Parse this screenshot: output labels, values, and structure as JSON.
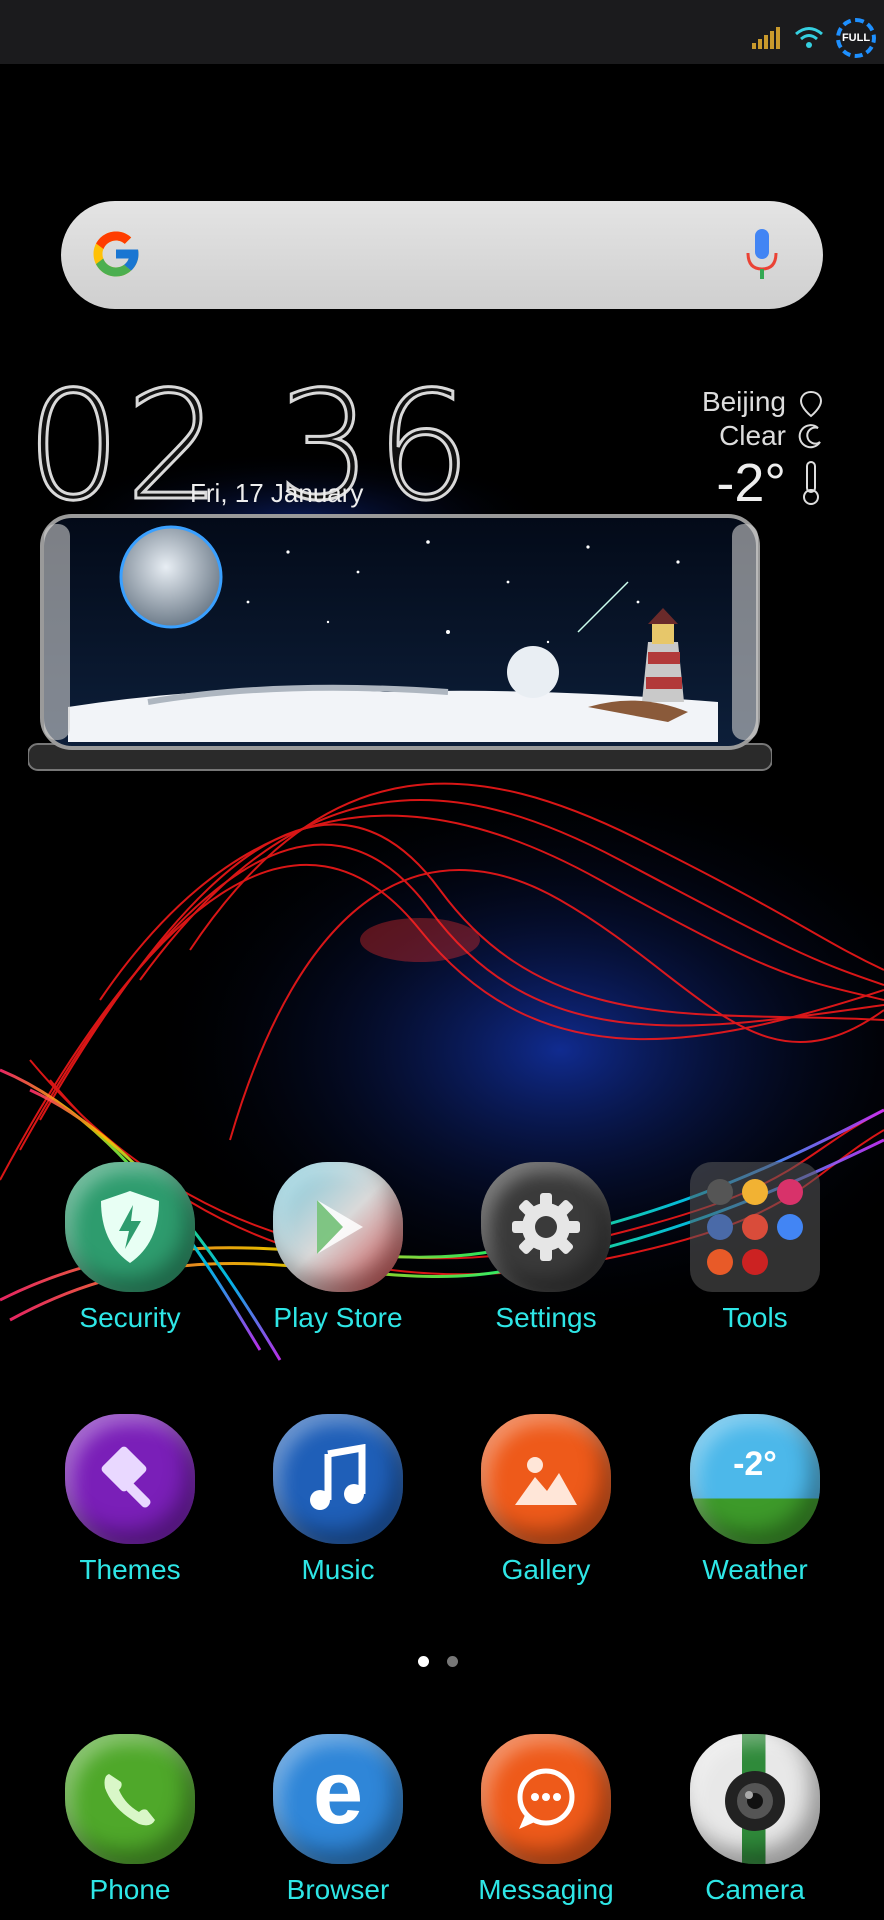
{
  "status_bar": {
    "battery_label": "FULL"
  },
  "search": {
    "placeholder": ""
  },
  "clock": {
    "time": "02 36",
    "date": "Fri, 17 January"
  },
  "weather_widget": {
    "city": "Beijing",
    "condition": "Clear",
    "temperature": "-2°"
  },
  "apps": {
    "row1": [
      {
        "label": "Security",
        "icon": "shield-icon",
        "color": "#2e9c6e"
      },
      {
        "label": "Play Store",
        "icon": "play-store-icon",
        "color": "#d9d9d9"
      },
      {
        "label": "Settings",
        "icon": "gear-icon",
        "color": "#3a3a3a"
      },
      {
        "label": "Tools",
        "icon": "folder-icon",
        "color": "#444"
      }
    ],
    "row2": [
      {
        "label": "Themes",
        "icon": "brush-icon",
        "color": "#7a1fb8"
      },
      {
        "label": "Music",
        "icon": "music-note-icon",
        "color": "#1f5fb8"
      },
      {
        "label": "Gallery",
        "icon": "gallery-icon",
        "color": "#ee5a1a"
      },
      {
        "label": "Weather",
        "icon": "weather-icon",
        "color": "#2ba5d8",
        "badge": "-2°"
      }
    ],
    "dock": [
      {
        "label": "Phone",
        "icon": "phone-icon",
        "color": "#4fa82a"
      },
      {
        "label": "Browser",
        "icon": "browser-icon",
        "color": "#2f86d8"
      },
      {
        "label": "Messaging",
        "icon": "message-icon",
        "color": "#ee5a1a"
      },
      {
        "label": "Camera",
        "icon": "camera-icon",
        "color": "#d8d8d8"
      }
    ]
  },
  "pager": {
    "pages": 2,
    "current": 1
  }
}
